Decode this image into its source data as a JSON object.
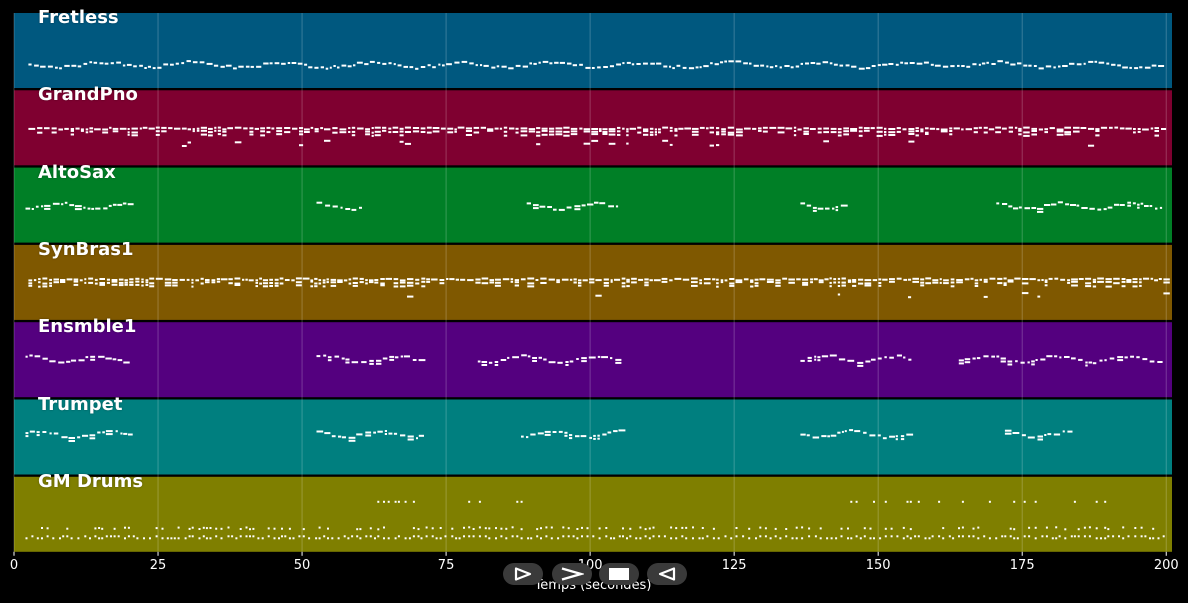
{
  "chart_data": {
    "type": "piano-roll",
    "xlabel": "Temps (secondes)",
    "xlim": [
      0,
      201
    ],
    "xticks": [
      0,
      25,
      50,
      75,
      100,
      125,
      150,
      175,
      200
    ],
    "tracks": [
      {
        "name": "Fretless",
        "color": "#00587f",
        "segments": [
          [
            2.5,
            199.5
          ]
        ],
        "pattern": "dense",
        "center": 0.68
      },
      {
        "name": "GrandPno",
        "color": "#7f0030",
        "segments": [
          [
            2.5,
            199.5
          ]
        ],
        "pattern": "chords",
        "center": 0.55
      },
      {
        "name": "AltoSax",
        "color": "#007f26",
        "segments": [
          [
            2,
            20.5
          ],
          [
            52.5,
            60
          ],
          [
            89,
            105
          ],
          [
            136.5,
            144.5
          ],
          [
            170.5,
            199.5
          ]
        ],
        "pattern": "melody",
        "center": 0.5
      },
      {
        "name": "SynBras1",
        "color": "#7f5800",
        "segments": [
          [
            2.5,
            199.5
          ]
        ],
        "pattern": "chords",
        "center": 0.5
      },
      {
        "name": "Ensmble1",
        "color": "#54007f",
        "segments": [
          [
            2,
            20.5
          ],
          [
            52.5,
            71
          ],
          [
            80.5,
            105
          ],
          [
            136.5,
            156
          ],
          [
            164,
            199.5
          ]
        ],
        "pattern": "melody",
        "center": 0.48
      },
      {
        "name": "Trumpet",
        "color": "#007f7f",
        "segments": [
          [
            2,
            20.5
          ],
          [
            52.5,
            71
          ],
          [
            88,
            105
          ],
          [
            136.5,
            156
          ],
          [
            172,
            183
          ]
        ],
        "pattern": "melody",
        "center": 0.45
      },
      {
        "name": "GM Drums",
        "color": "#7f7f00",
        "segments": [
          [
            2,
            199.5
          ]
        ],
        "pattern": "drums",
        "center": 0.7
      }
    ]
  },
  "controls": [
    {
      "name": "play-outline-button",
      "icon": "play-outline-icon"
    },
    {
      "name": "fast-forward-button",
      "icon": "chevron-right-icon"
    },
    {
      "name": "stop-button",
      "icon": "stop-icon"
    },
    {
      "name": "rewind-button",
      "icon": "play-left-outline-icon"
    }
  ]
}
